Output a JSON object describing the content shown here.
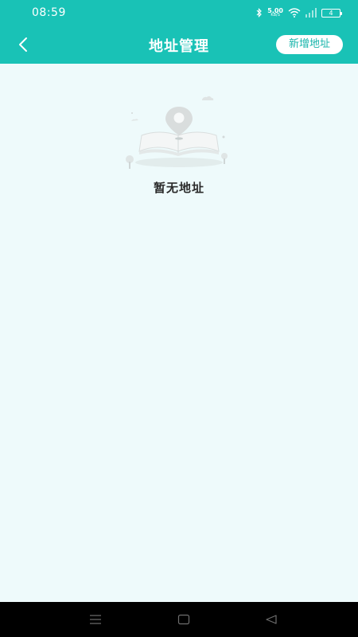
{
  "status_bar": {
    "time": "08:59",
    "net_speed": "5.00",
    "net_speed_unit": "KB/S",
    "battery": "4",
    "icons": [
      "bluetooth-icon",
      "wifi-icon",
      "signal-icon",
      "battery-icon"
    ]
  },
  "app_bar": {
    "title": "地址管理",
    "back_icon": "chevron-left-icon",
    "add_button_label": "新增地址"
  },
  "empty_state": {
    "illustration": "map-location-illustration",
    "message": "暂无地址"
  },
  "nav_bar": {
    "icons": [
      "menu-icon",
      "home-icon",
      "back-icon"
    ]
  },
  "colors": {
    "header": "#19c2b6",
    "background": "#eefafb",
    "add_button_text": "#19b5ab",
    "nav_bar": "#000000"
  }
}
